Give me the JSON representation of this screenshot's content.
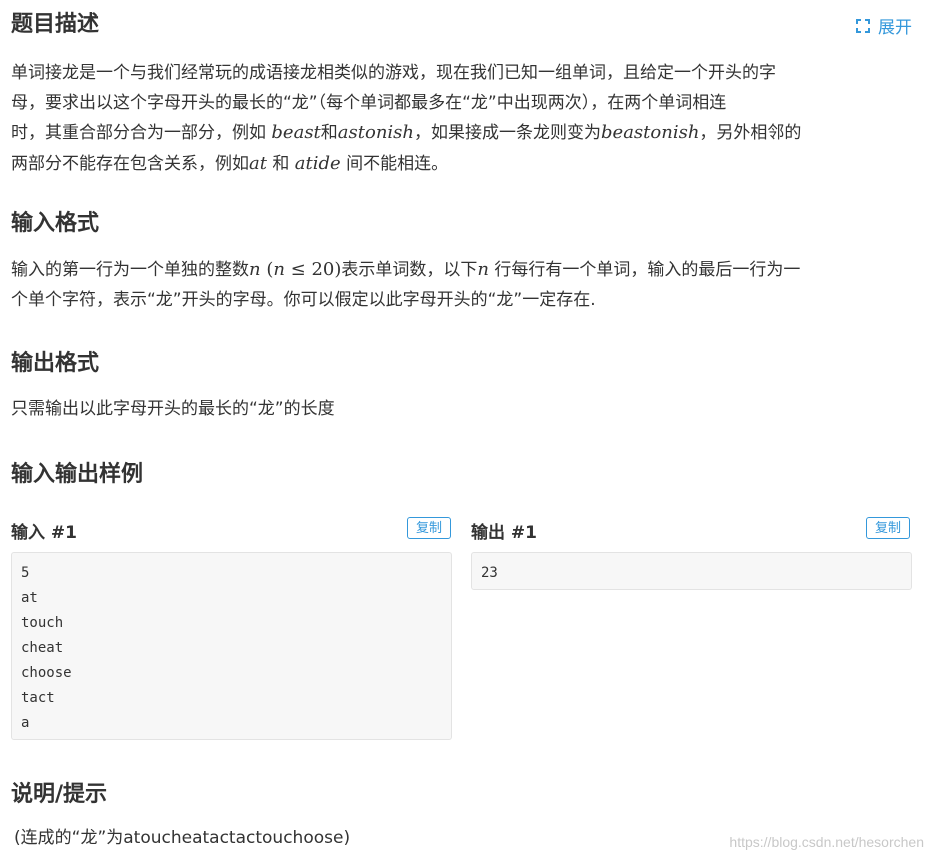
{
  "header": {
    "title": "题目描述",
    "expand_label": "展开"
  },
  "description": {
    "line1_a": "单词接龙是一个与我们经常玩的成语接龙相类似的游戏，现在我们已知一组单词，且给定一个开头的字",
    "line2_a": "母，要求出以这个字母开头的最长的“龙”（每个单词都最多在“龙”中出现两次），在两个单词相连",
    "line3_a": "时，其重合部分合为一部分，例如 ",
    "line3_m1": "beast",
    "line3_b": "和",
    "line3_m2": "astonish",
    "line3_c": "，如果接成一条龙则变为",
    "line3_m3": "beastonish",
    "line3_d": "，另外相邻的",
    "line4_a": "两部分不能存在包含关系，例如",
    "line4_m1": "at",
    "line4_b": " 和 ",
    "line4_m2": "atide",
    "line4_c": " 间不能相连。"
  },
  "input_format": {
    "title": "输入格式",
    "line1_a": "输入的第一行为一个单独的整数",
    "line1_m1": "n",
    "line1_m2_open": " (",
    "line1_m2_n": "n",
    "line1_m2_rest": " ≤ 20)",
    "line1_b": "表示单词数，以下",
    "line1_m3": "n",
    "line1_c": " 行每行有一个单词，输入的最后一行为一",
    "line2": "个单个字符，表示“龙”开头的字母。你可以假定以此字母开头的“龙”一定存在."
  },
  "output_format": {
    "title": "输出格式",
    "text": "只需输出以此字母开头的最长的“龙”的长度"
  },
  "samples": {
    "title": "输入输出样例",
    "input_label": "输入 #1",
    "output_label": "输出 #1",
    "copy_label": "复制",
    "input_lines": [
      "5",
      "at",
      "touch",
      "cheat",
      "choose",
      "tact",
      "a"
    ],
    "output_lines": [
      "23"
    ]
  },
  "hint": {
    "title": "说明/提示",
    "text": "(连成的“龙”为atoucheatactactouchoose)"
  },
  "watermark": "https://blog.csdn.net/hesorchen",
  "colors": {
    "accent": "#3498db",
    "text": "#333333",
    "code_bg": "#f7f7f7",
    "code_border": "#e3e3e3"
  }
}
